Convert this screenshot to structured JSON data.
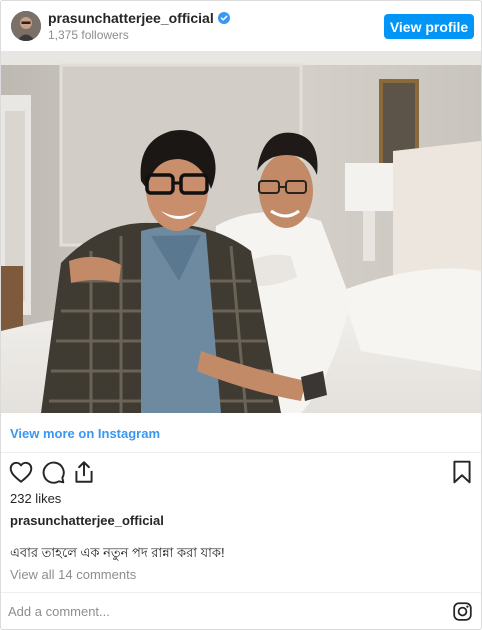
{
  "header": {
    "username": "prasunchatterjee_official",
    "followers": "1,375 followers",
    "view_profile_label": "View profile",
    "verified": true
  },
  "post": {
    "image_description_icon": "photo",
    "view_more_label": "View more on Instagram",
    "likes": "232 likes",
    "caption_user": "prasunchatterjee_official",
    "caption_text": "এবার তাহলে এক নতুন পদ রান্না করা যাক!",
    "view_comments": "View all 14 comments"
  },
  "actions": {
    "like_icon": "heart-icon",
    "comment_icon": "comment-icon",
    "share_icon": "share-icon",
    "save_icon": "bookmark-icon"
  },
  "comment": {
    "placeholder": "Add a comment...",
    "brand_icon": "instagram-icon"
  },
  "colors": {
    "accent": "#0095f6",
    "link": "#3897f0",
    "muted": "#8e8e8e",
    "text": "#262626",
    "verified": "#3897f0"
  }
}
